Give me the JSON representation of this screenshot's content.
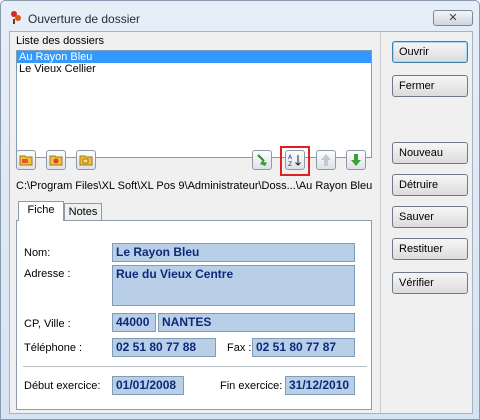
{
  "window": {
    "title": "Ouverture de dossier",
    "close_glyph": "✕"
  },
  "folders": {
    "label": "Liste des dossiers",
    "items": [
      "Au Rayon Bleu",
      "Le Vieux Cellier"
    ],
    "selected_index": 0
  },
  "toolbar": {
    "icons": [
      "folder-open-icon",
      "folder-new-icon",
      "folder-copy-icon",
      "broom-icon",
      "sort-az-icon",
      "arrow-up-icon",
      "arrow-down-icon"
    ]
  },
  "path": "C:\\Program Files\\XL Soft\\XL Pos 9\\Administrateur\\Doss...\\Au Rayon Bleu",
  "tabs": [
    "Fiche",
    "Notes"
  ],
  "form": {
    "nom_label": "Nom:",
    "nom": "Le Rayon Bleu",
    "adresse_label": "Adresse :",
    "adresse": "Rue du Vieux Centre",
    "cp_ville_label": "CP, Ville :",
    "cp": "44000",
    "ville": "NANTES",
    "tel_label": "Téléphone :",
    "tel": "02 51 80 77 88",
    "fax_label": "Fax :",
    "fax": "02 51 80 77 87",
    "debut_label": "Début exercice:",
    "debut": "01/01/2008",
    "fin_label": "Fin exercice:",
    "fin": "31/12/2010"
  },
  "buttons": {
    "ouvrir": "Ouvrir",
    "fermer": "Fermer",
    "nouveau": "Nouveau",
    "detruire": "Détruire",
    "sauver": "Sauver",
    "restituer": "Restituer",
    "verifier": "Vérifier"
  },
  "colors": {
    "selection": "#3399ff",
    "field_bg": "#b9cfe8",
    "field_text": "#0d2a7a",
    "highlight": "#e02020"
  }
}
